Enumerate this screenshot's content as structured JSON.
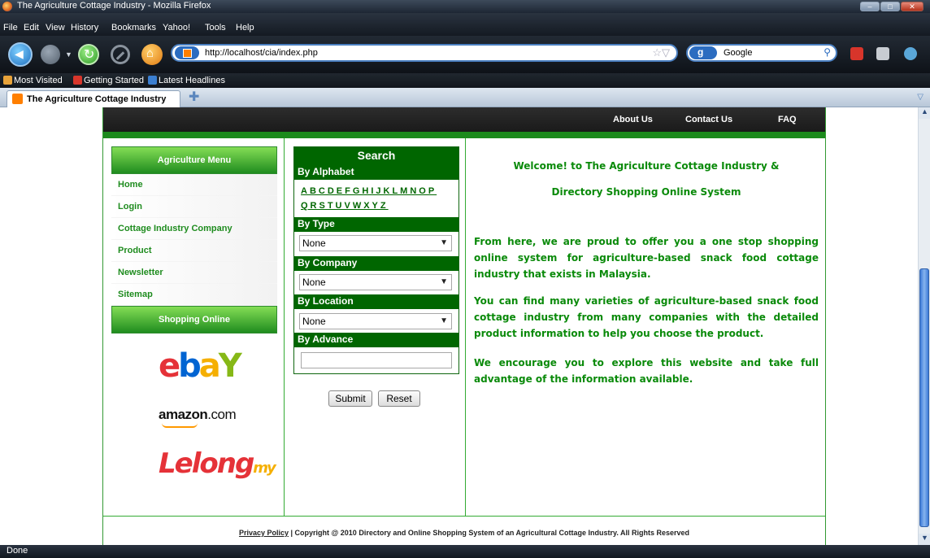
{
  "browser": {
    "window_title": "The Agriculture Cottage Industry - Mozilla Firefox",
    "menu": [
      "File",
      "Edit",
      "View",
      "History",
      "Bookmarks",
      "Yahoo!",
      "Tools",
      "Help"
    ],
    "url": "http://localhost/cia/index.php",
    "search_engine": "Google",
    "bookmarks": [
      "Most Visited",
      "Getting Started",
      "Latest Headlines"
    ],
    "tab_title": "The Agriculture Cottage Industry",
    "status": "Done"
  },
  "page": {
    "topnav": [
      "About Us",
      "Contact Us",
      "FAQ"
    ],
    "sidebar": {
      "menu_heading": "Agriculture Menu",
      "links": [
        "Home",
        "Login",
        "Cottage Industry Company",
        "Product",
        "Newsletter",
        "Sitemap"
      ],
      "shopping_heading": "Shopping Online",
      "logos": {
        "ebay": [
          "e",
          "b",
          "a",
          "Y"
        ],
        "amazon": "amazon",
        "amazon_suffix": ".com",
        "lelong": "Lelong",
        "lelong_suffix": "my"
      }
    },
    "search": {
      "title": "Search",
      "by_alphabet": "By Alphabet",
      "alphabet_row1": "ABCDEFGHIJKLMNOP",
      "alphabet_row2": "QRSTUVWXYZ",
      "by_type": "By Type",
      "type_value": "None",
      "by_company": "By Company",
      "company_value": "None",
      "by_location": "By Location",
      "location_value": "None",
      "by_advance": "By Advance",
      "advance_value": "",
      "submit": "Submit",
      "reset": "Reset"
    },
    "welcome": {
      "heading1": "Welcome! to The Agriculture Cottage Industry &",
      "heading2": "Directory Shopping Online System",
      "para1": "From here, we are proud to offer you a one stop shopping online system for agriculture-based snack food cottage industry that exists in Malaysia.",
      "para2": "You can find many varieties of agriculture-based snack food cottage industry from many companies with the detailed product information to help you choose the product.",
      "para3": "We encourage you to explore this website and take full advantage of the information available."
    },
    "footer": {
      "privacy": "Privacy Policy",
      "copyright": " | Copyright @ 2010 Directory and Online Shopping System of an Agricultural Cottage Industry. All Rights Reserved"
    }
  },
  "colors": {
    "accent_green": "#1f8c1f",
    "dark_green": "#006600",
    "text_green": "#0a8a0a"
  }
}
